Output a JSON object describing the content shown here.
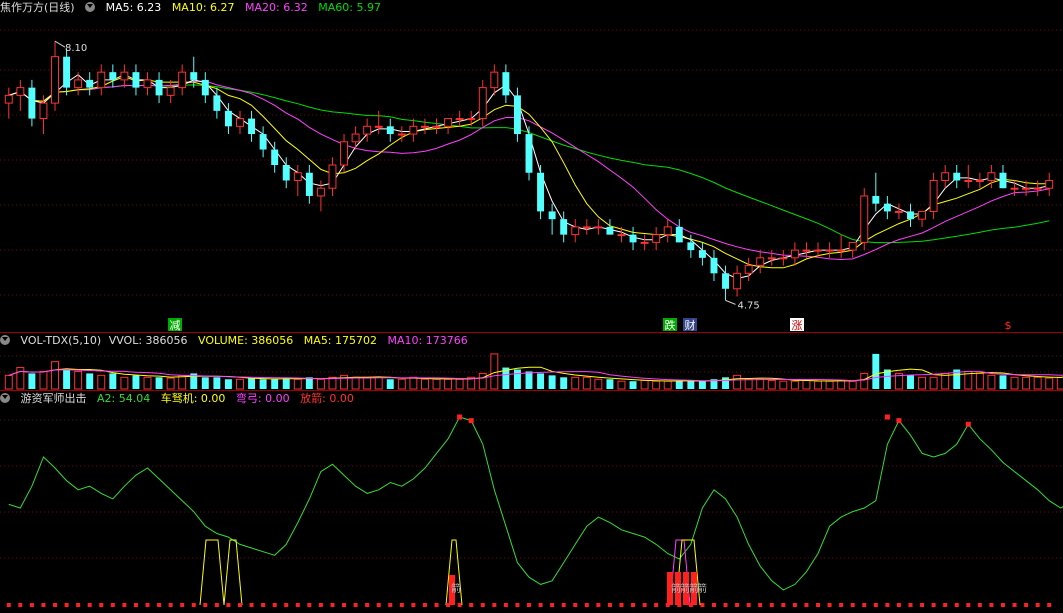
{
  "panel_price": {
    "title": "焦作万方(日线)",
    "ma5": "MA5: 6.23",
    "ma10": "MA10: 6.27",
    "ma20": "MA20: 6.32",
    "ma60": "MA60: 5.97",
    "high_label": "8.10",
    "low_label": "4.75",
    "markers": [
      "减",
      "跌",
      "财",
      "涨",
      "$"
    ]
  },
  "panel_volume": {
    "title": "VOL-TDX(5,10)",
    "vvol": "VVOL: 386056",
    "volume": "VOLUME: 386056",
    "ma5": "MA5: 175702",
    "ma10": "MA10: 173766"
  },
  "panel_indicator": {
    "title": "游资军师出击",
    "a2": "A2: 54.04",
    "chejiji": "车驽机: 0.00",
    "gong": "弯弓: 0.00",
    "fangjian": "放箭: 0.00",
    "arrow_char": "箭"
  },
  "colors": {
    "up": "#ff3232",
    "down": "#54ffff",
    "ma5": "#ffffff",
    "ma10": "#ffff00",
    "ma20": "#ff40ff",
    "ma60": "#00dd00",
    "grid": "#7a0000",
    "a2": "#33dd33"
  },
  "chart_data": [
    {
      "type": "candlestick",
      "title": "焦作万方(日线)",
      "series": [
        {
          "name": "MA5",
          "last": 6.23
        },
        {
          "name": "MA10",
          "last": 6.27
        },
        {
          "name": "MA20",
          "last": 6.32
        },
        {
          "name": "MA60",
          "last": 5.97
        }
      ],
      "ohlc": [
        [
          7.3,
          7.5,
          7.1,
          7.4
        ],
        [
          7.4,
          7.6,
          7.2,
          7.5
        ],
        [
          7.5,
          7.6,
          7.0,
          7.1
        ],
        [
          7.1,
          7.4,
          6.9,
          7.3
        ],
        [
          7.3,
          8.1,
          7.2,
          7.9
        ],
        [
          7.9,
          8.0,
          7.4,
          7.5
        ],
        [
          7.5,
          7.7,
          7.4,
          7.6
        ],
        [
          7.6,
          7.7,
          7.4,
          7.5
        ],
        [
          7.5,
          7.8,
          7.4,
          7.7
        ],
        [
          7.7,
          7.8,
          7.5,
          7.6
        ],
        [
          7.6,
          7.8,
          7.5,
          7.7
        ],
        [
          7.7,
          7.8,
          7.4,
          7.5
        ],
        [
          7.5,
          7.7,
          7.4,
          7.6
        ],
        [
          7.6,
          7.7,
          7.3,
          7.4
        ],
        [
          7.4,
          7.6,
          7.3,
          7.5
        ],
        [
          7.5,
          7.8,
          7.4,
          7.7
        ],
        [
          7.7,
          7.9,
          7.5,
          7.6
        ],
        [
          7.6,
          7.7,
          7.3,
          7.4
        ],
        [
          7.4,
          7.5,
          7.1,
          7.2
        ],
        [
          7.2,
          7.3,
          6.9,
          7.0
        ],
        [
          7.0,
          7.2,
          6.9,
          7.1
        ],
        [
          7.1,
          7.2,
          6.8,
          6.9
        ],
        [
          6.9,
          7.0,
          6.6,
          6.7
        ],
        [
          6.7,
          6.8,
          6.4,
          6.5
        ],
        [
          6.5,
          6.6,
          6.2,
          6.3
        ],
        [
          6.3,
          6.5,
          6.1,
          6.4
        ],
        [
          6.4,
          6.5,
          6.0,
          6.1
        ],
        [
          6.1,
          6.3,
          5.9,
          6.2
        ],
        [
          6.2,
          6.6,
          6.1,
          6.5
        ],
        [
          6.5,
          6.9,
          6.4,
          6.8
        ],
        [
          6.8,
          7.0,
          6.7,
          6.9
        ],
        [
          6.9,
          7.1,
          6.8,
          7.0
        ],
        [
          7.0,
          7.2,
          6.9,
          7.0
        ],
        [
          7.0,
          7.1,
          6.8,
          6.9
        ],
        [
          6.9,
          7.0,
          6.8,
          6.9
        ],
        [
          6.9,
          7.1,
          6.8,
          7.0
        ],
        [
          7.0,
          7.1,
          6.9,
          7.0
        ],
        [
          7.0,
          7.1,
          6.9,
          7.0
        ],
        [
          7.0,
          7.1,
          6.9,
          7.1
        ],
        [
          7.1,
          7.2,
          7.0,
          7.1
        ],
        [
          7.1,
          7.2,
          7.0,
          7.1
        ],
        [
          7.1,
          7.6,
          7.0,
          7.5
        ],
        [
          7.5,
          7.8,
          7.4,
          7.7
        ],
        [
          7.7,
          7.8,
          7.3,
          7.4
        ],
        [
          7.4,
          7.5,
          6.8,
          6.9
        ],
        [
          6.9,
          7.0,
          6.3,
          6.4
        ],
        [
          6.4,
          6.5,
          5.8,
          5.9
        ],
        [
          5.9,
          6.0,
          5.6,
          5.8
        ],
        [
          5.8,
          5.9,
          5.5,
          5.6
        ],
        [
          5.6,
          5.8,
          5.5,
          5.7
        ],
        [
          5.7,
          5.8,
          5.6,
          5.7
        ],
        [
          5.7,
          5.8,
          5.6,
          5.7
        ],
        [
          5.7,
          5.8,
          5.6,
          5.6
        ],
        [
          5.6,
          5.7,
          5.5,
          5.6
        ],
        [
          5.6,
          5.7,
          5.4,
          5.5
        ],
        [
          5.5,
          5.6,
          5.4,
          5.5
        ],
        [
          5.5,
          5.7,
          5.4,
          5.6
        ],
        [
          5.6,
          5.8,
          5.5,
          5.7
        ],
        [
          5.7,
          5.8,
          5.5,
          5.5
        ],
        [
          5.5,
          5.6,
          5.3,
          5.4
        ],
        [
          5.4,
          5.5,
          5.2,
          5.3
        ],
        [
          5.3,
          5.4,
          5.0,
          5.1
        ],
        [
          5.1,
          5.2,
          4.75,
          4.9
        ],
        [
          4.9,
          5.2,
          4.8,
          5.1
        ],
        [
          5.1,
          5.3,
          5.0,
          5.2
        ],
        [
          5.2,
          5.4,
          5.1,
          5.3
        ],
        [
          5.3,
          5.4,
          5.2,
          5.3
        ],
        [
          5.3,
          5.4,
          5.2,
          5.3
        ],
        [
          5.3,
          5.5,
          5.2,
          5.4
        ],
        [
          5.4,
          5.5,
          5.3,
          5.4
        ],
        [
          5.4,
          5.5,
          5.3,
          5.4
        ],
        [
          5.4,
          5.5,
          5.3,
          5.4
        ],
        [
          5.4,
          5.6,
          5.3,
          5.4
        ],
        [
          5.4,
          5.5,
          5.3,
          5.5
        ],
        [
          5.5,
          6.2,
          5.4,
          6.1
        ],
        [
          6.1,
          6.4,
          5.9,
          6.0
        ],
        [
          6.0,
          6.1,
          5.8,
          5.9
        ],
        [
          5.9,
          6.0,
          5.8,
          5.9
        ],
        [
          5.9,
          6.0,
          5.7,
          5.8
        ],
        [
          5.8,
          5.9,
          5.7,
          5.9
        ],
        [
          5.9,
          6.4,
          5.8,
          6.3
        ],
        [
          6.3,
          6.5,
          6.2,
          6.4
        ],
        [
          6.4,
          6.5,
          6.2,
          6.3
        ],
        [
          6.3,
          6.5,
          6.2,
          6.3
        ],
        [
          6.3,
          6.4,
          6.2,
          6.3
        ],
        [
          6.3,
          6.5,
          6.2,
          6.4
        ],
        [
          6.4,
          6.5,
          6.2,
          6.2
        ],
        [
          6.2,
          6.3,
          6.1,
          6.2
        ],
        [
          6.2,
          6.3,
          6.1,
          6.2
        ],
        [
          6.2,
          6.3,
          6.1,
          6.2
        ],
        [
          6.2,
          6.4,
          6.1,
          6.3
        ]
      ]
    },
    {
      "type": "bar",
      "title": "VOL-TDX(5,10)",
      "series": [
        {
          "name": "VOLUME",
          "last": 386056
        },
        {
          "name": "MA5",
          "last": 175702
        },
        {
          "name": "MA10",
          "last": 173766
        }
      ],
      "values_relative": [
        0.35,
        0.55,
        0.4,
        0.45,
        0.7,
        0.5,
        0.45,
        0.4,
        0.35,
        0.4,
        0.3,
        0.35,
        0.3,
        0.3,
        0.28,
        0.35,
        0.4,
        0.3,
        0.3,
        0.25,
        0.25,
        0.28,
        0.25,
        0.25,
        0.28,
        0.25,
        0.3,
        0.25,
        0.3,
        0.35,
        0.3,
        0.3,
        0.3,
        0.25,
        0.25,
        0.3,
        0.25,
        0.25,
        0.25,
        0.25,
        0.3,
        0.4,
        0.9,
        0.55,
        0.5,
        0.45,
        0.4,
        0.35,
        0.3,
        0.3,
        0.3,
        0.25,
        0.25,
        0.2,
        0.2,
        0.22,
        0.2,
        0.2,
        0.2,
        0.22,
        0.2,
        0.25,
        0.3,
        0.35,
        0.25,
        0.25,
        0.22,
        0.2,
        0.2,
        0.22,
        0.2,
        0.2,
        0.22,
        0.2,
        0.4,
        0.9,
        0.5,
        0.4,
        0.35,
        0.3,
        0.3,
        0.4,
        0.5,
        0.45,
        0.4,
        0.35,
        0.35,
        0.3,
        0.3,
        0.3,
        0.28,
        0.3,
        0.6
      ]
    },
    {
      "type": "line",
      "title": "游资军师出击",
      "series": [
        {
          "name": "A2",
          "last": 54.04
        },
        {
          "name": "车驽机",
          "last": 0
        },
        {
          "name": "弯弓",
          "last": 0
        },
        {
          "name": "放箭",
          "last": 0
        }
      ],
      "ylim": [
        0,
        100
      ]
    }
  ]
}
